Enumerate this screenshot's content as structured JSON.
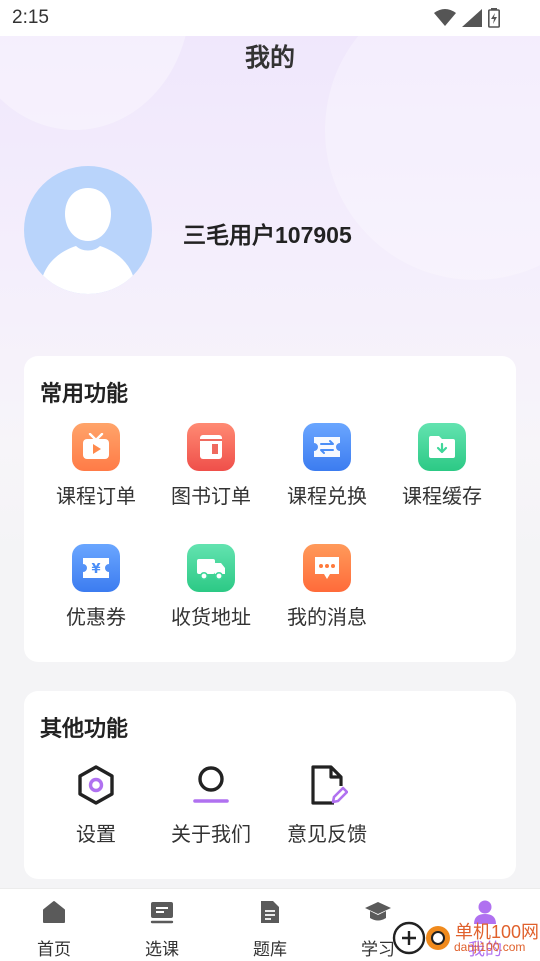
{
  "status_bar": {
    "time": "2:15"
  },
  "header": {
    "title": "我的"
  },
  "profile": {
    "username": "三毛用户107905"
  },
  "common_functions": {
    "title": "常用功能",
    "items": [
      {
        "label": "课程订单",
        "icon": "tv-icon",
        "color": "#ff8a4c"
      },
      {
        "label": "图书订单",
        "icon": "book-icon",
        "color": "#f25c52"
      },
      {
        "label": "课程兑换",
        "icon": "exchange-ticket-icon",
        "color": "#4a8ef7"
      },
      {
        "label": "课程缓存",
        "icon": "download-folder-icon",
        "color": "#3fd79a"
      },
      {
        "label": "优惠券",
        "icon": "coupon-icon",
        "color": "#4a8ef7"
      },
      {
        "label": "收货地址",
        "icon": "delivery-truck-icon",
        "color": "#3fd79a"
      },
      {
        "label": "我的消息",
        "icon": "message-icon",
        "color": "#ff7a3c"
      }
    ]
  },
  "other_functions": {
    "title": "其他功能",
    "items": [
      {
        "label": "设置",
        "icon": "settings-icon"
      },
      {
        "label": "关于我们",
        "icon": "about-us-icon"
      },
      {
        "label": "意见反馈",
        "icon": "feedback-icon"
      }
    ]
  },
  "bottom_nav": {
    "items": [
      {
        "label": "首页",
        "icon": "home-icon"
      },
      {
        "label": "选课",
        "icon": "course-list-icon"
      },
      {
        "label": "题库",
        "icon": "question-bank-icon"
      },
      {
        "label": "学习",
        "icon": "graduation-cap-icon"
      },
      {
        "label": "我的",
        "icon": "profile-icon",
        "active": true
      }
    ]
  },
  "watermark": {
    "text": "单机100网",
    "subtext": "danji100.com"
  },
  "colors": {
    "accent": "#b071f0",
    "avatar_bg": "#b9d4fb"
  }
}
